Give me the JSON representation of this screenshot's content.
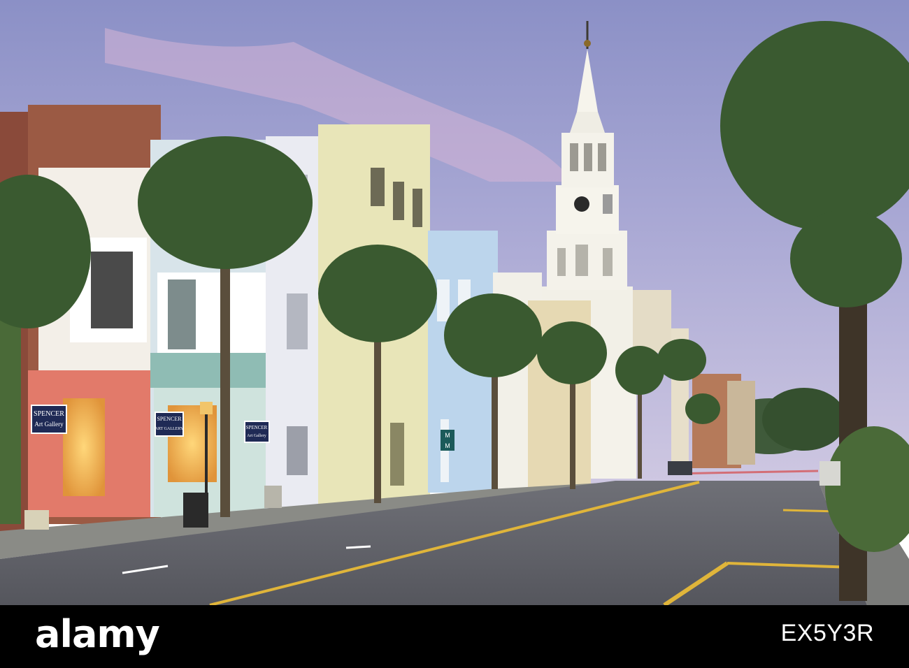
{
  "photo": {
    "description_tag": "street-scene",
    "signs": {
      "gallery_1_line1": "SPENCER",
      "gallery_1_line2": "Art Gallery",
      "gallery_2_line1": "SPENCER",
      "gallery_2_line2": "ART GALLERY",
      "gallery_3_line1": "SPENCER",
      "gallery_3_line2": "Art Gallery",
      "sign_m1": "M",
      "sign_m2": "M"
    }
  },
  "footer": {
    "logo_text": "alamy",
    "image_id": "EX5Y3R",
    "background": "#000000",
    "text_color": "#ffffff"
  },
  "colors": {
    "sky_top": "#8f93c8",
    "sky_bottom": "#c9c2e0",
    "road": "#5d5f66",
    "road_line": "#e0b53a",
    "palm_green": "#3d5a2e",
    "steeple": "#f1efe6"
  }
}
